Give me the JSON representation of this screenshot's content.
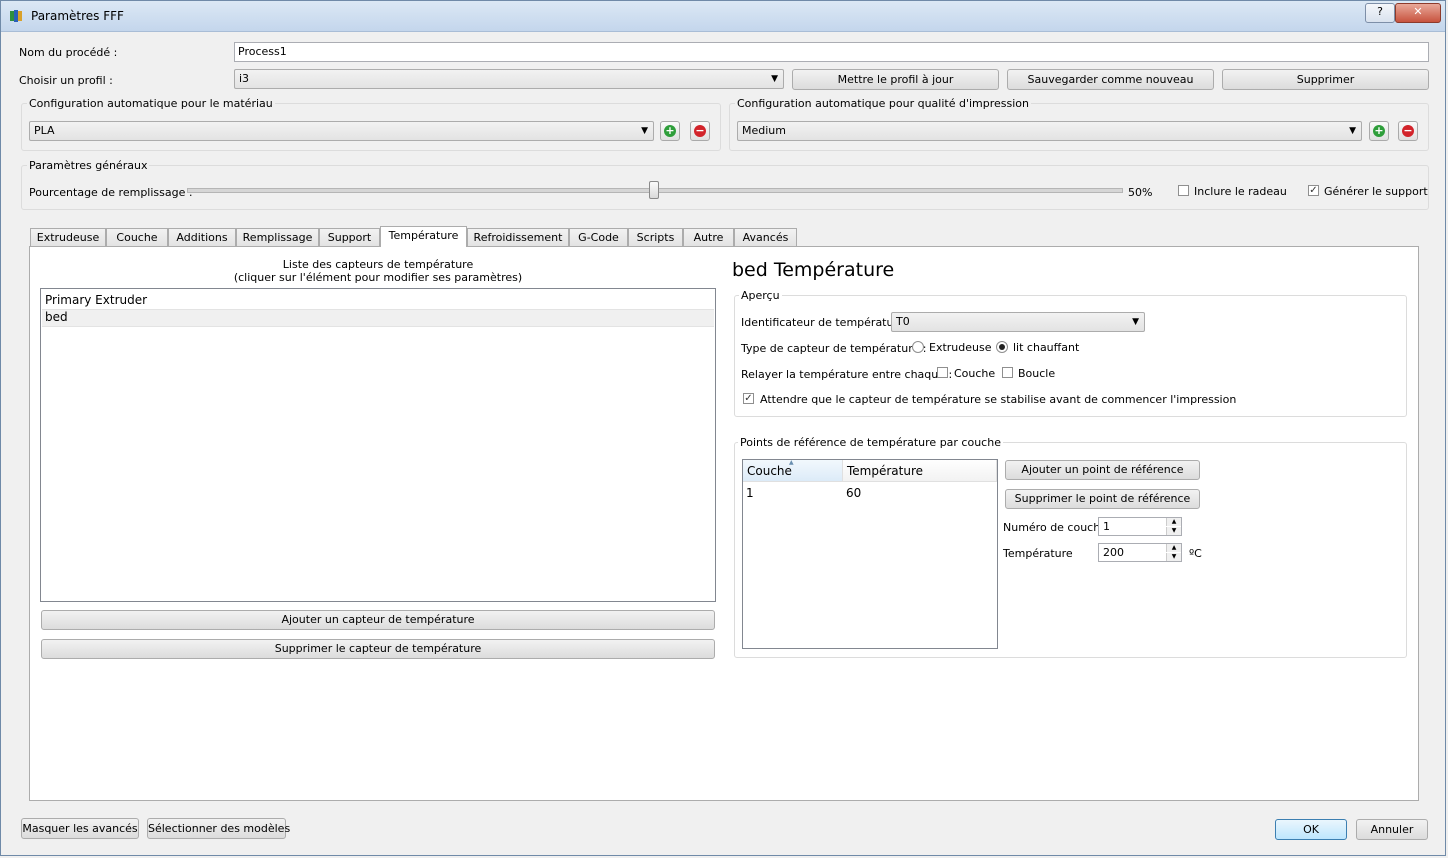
{
  "window": {
    "title": "Paramètres FFF",
    "help": "?",
    "close": "✕"
  },
  "process": {
    "label": "Nom du procédé :",
    "value": "Process1"
  },
  "profile": {
    "label": "Choisir un profil :",
    "value": "i3",
    "update": "Mettre le profil à jour",
    "save_new": "Sauvegarder comme nouveau",
    "delete": "Supprimer"
  },
  "material": {
    "title": "Configuration automatique pour le matériau",
    "value": "PLA"
  },
  "quality": {
    "title": "Configuration automatique pour qualité d'impression",
    "value": "Medium"
  },
  "general": {
    "title": "Paramètres généraux",
    "infill_label": "Pourcentage de remplissage :",
    "infill_value": "50%",
    "infill_fraction": 0.5,
    "raft_label": "Inclure le radeau",
    "raft_checked": false,
    "support_label": "Générer le support",
    "support_checked": true
  },
  "tabs": [
    "Extrudeuse",
    "Couche",
    "Additions",
    "Remplissage",
    "Support",
    "Température",
    "Refroidissement",
    "G-Code",
    "Scripts",
    "Autre",
    "Avancés"
  ],
  "sensors": {
    "list_title_1": "Liste des capteurs de température",
    "list_title_2": "(cliquer sur l'élément pour modifier ses paramètres)",
    "items": [
      "Primary Extruder",
      "bed"
    ],
    "add": "Ajouter un capteur de température",
    "remove": "Supprimer le capteur de température"
  },
  "detail": {
    "heading": "bed Température",
    "overview_title": "Aperçu",
    "id_label": "Identificateur de température",
    "id_value": "T0",
    "type_label": "Type de capteur de température :",
    "type_extruder": "Extrudeuse",
    "type_bed": "lit chauffant",
    "relay_label": "Relayer la température entre chaque :",
    "relay_layer": "Couche",
    "relay_loop": "Boucle",
    "wait_label": "Attendre que le capteur de température se stabilise avant de commencer l'impression",
    "wait_checked": true
  },
  "setpoints": {
    "title": "Points de référence de température par couche",
    "col_layer": "Couche",
    "col_temp": "Température",
    "rows": [
      {
        "layer": "1",
        "temp": "60"
      }
    ],
    "add": "Ajouter un point de référence",
    "remove": "Supprimer le point de référence",
    "layer_label": "Numéro de couche",
    "layer_value": "1",
    "temp_label": "Température",
    "temp_value": "200",
    "temp_unit": "ºC"
  },
  "footer": {
    "hide_advanced": "Masquer les avancés",
    "select_models": "Sélectionner des modèles",
    "ok": "OK",
    "cancel": "Annuler"
  },
  "colors": {
    "add_green": "#2e9e3a",
    "remove_red": "#d2232a",
    "accent": "#3c7fb1"
  }
}
